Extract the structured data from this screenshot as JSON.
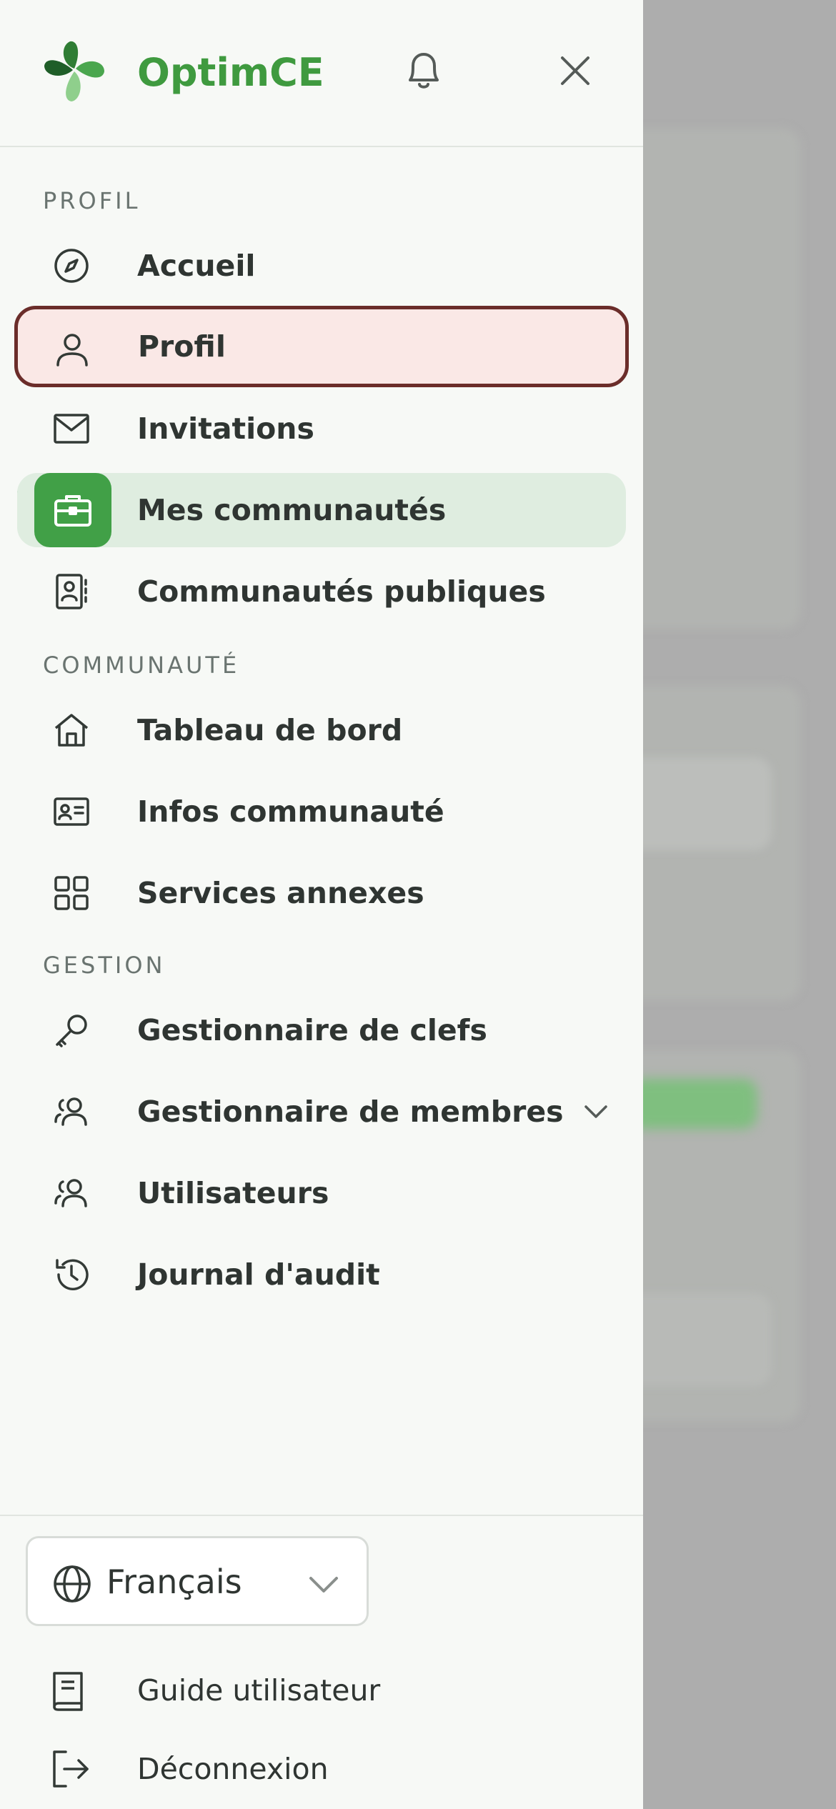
{
  "app": {
    "brand": "OptimCE",
    "colors": {
      "accent": "#41a047",
      "highlight_bg": "#fae8e6",
      "highlight_border": "#6b2d2a",
      "active_bg": "#dfede0"
    }
  },
  "header": {
    "bell_icon": "bell-icon",
    "close_icon": "close-icon"
  },
  "sections": {
    "profil": "PROFIL",
    "communaute": "COMMUNAUTÉ",
    "gestion": "GESTION"
  },
  "nav": {
    "accueil": "Accueil",
    "profil": "Profil",
    "invitations": "Invitations",
    "mes_communautes": "Mes communautés",
    "communautes_publiques": "Communautés publiques",
    "tableau_de_bord": "Tableau de bord",
    "infos_communaute": "Infos communauté",
    "services_annexes": "Services annexes",
    "gestionnaire_clefs": "Gestionnaire de clefs",
    "gestionnaire_membres": "Gestionnaire de membres",
    "utilisateurs": "Utilisateurs",
    "journal_audit": "Journal d'audit"
  },
  "footer": {
    "language": "Français",
    "guide": "Guide utilisateur",
    "logout": "Déconnexion"
  }
}
